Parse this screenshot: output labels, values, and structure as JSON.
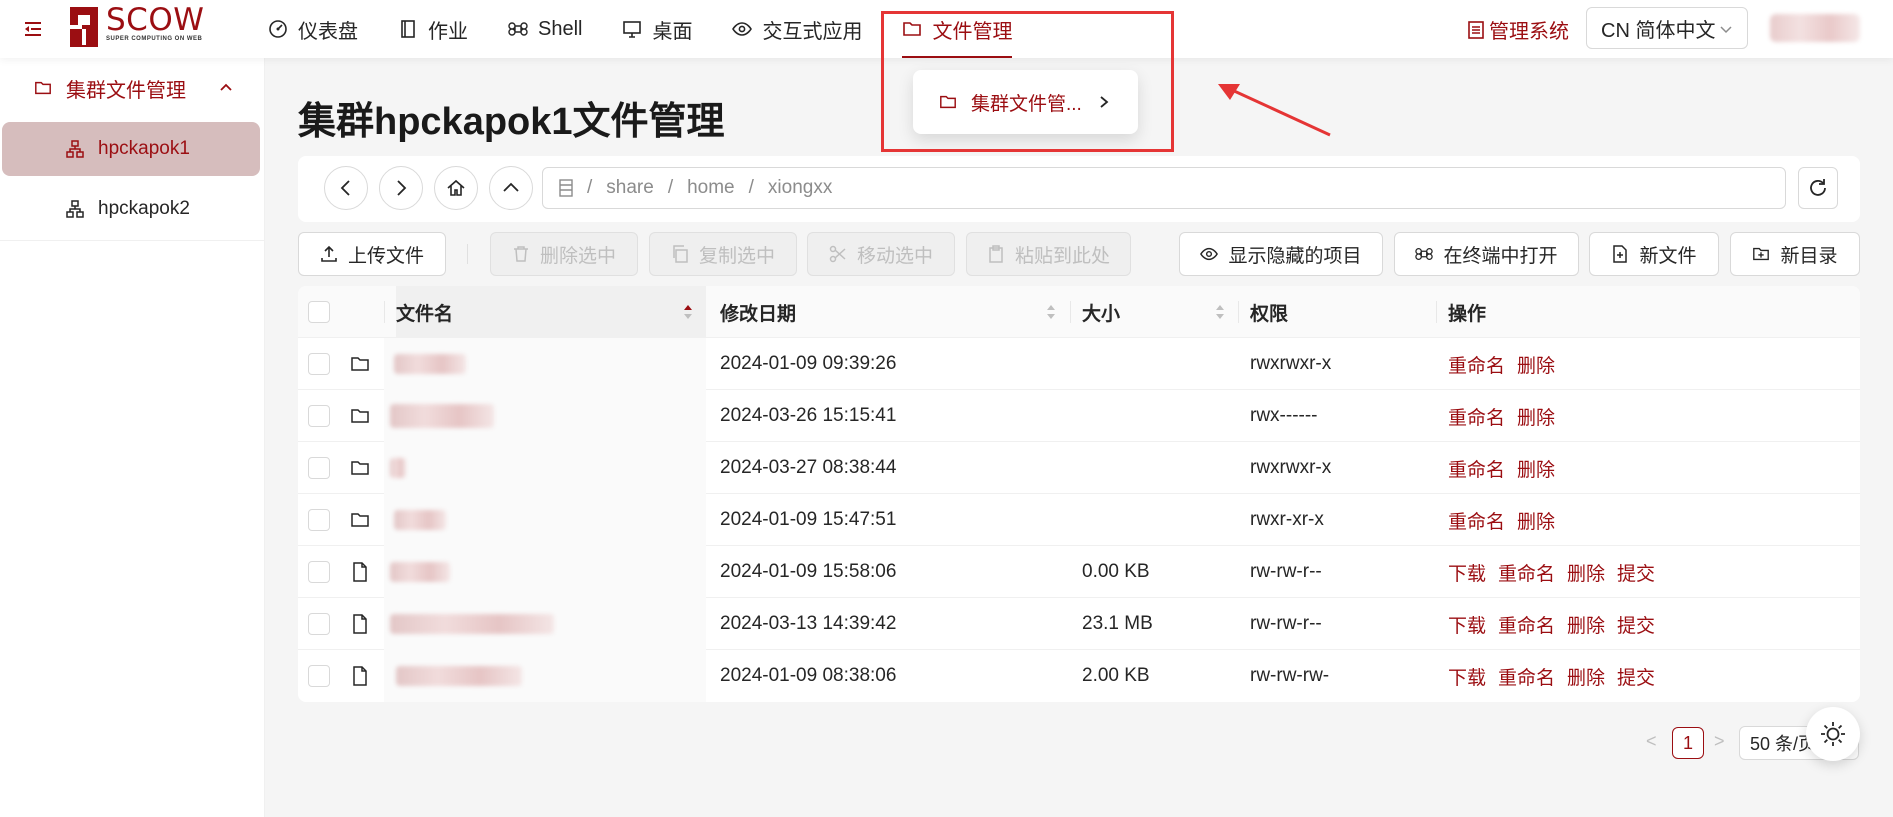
{
  "header": {
    "logo_text": "SCOW",
    "logo_subtitle": "SUPER COMPUTING ON WEB",
    "nav": [
      {
        "label": "仪表盘",
        "icon": "dashboard-icon"
      },
      {
        "label": "作业",
        "icon": "book-icon"
      },
      {
        "label": "Shell",
        "icon": "command-icon"
      },
      {
        "label": "桌面",
        "icon": "desktop-icon"
      },
      {
        "label": "交互式应用",
        "icon": "eye-icon"
      },
      {
        "label": "文件管理",
        "icon": "folder-icon",
        "active": true
      }
    ],
    "admin_link": "管理系统",
    "language": "CN 简体中文"
  },
  "dropdown": {
    "item": "集群文件管..."
  },
  "sidebar": {
    "group": "集群文件管理",
    "items": [
      {
        "label": "hpckapok1",
        "active": true
      },
      {
        "label": "hpckapok2",
        "active": false
      }
    ]
  },
  "main": {
    "title": "集群hpckapok1文件管理",
    "path": [
      "share",
      "home",
      "xiongxx"
    ],
    "toolbar": {
      "upload": "上传文件",
      "delete": "删除选中",
      "copy": "复制选中",
      "move": "移动选中",
      "paste": "粘贴到此处",
      "show_hidden": "显示隐藏的项目",
      "open_terminal": "在终端中打开",
      "new_file": "新文件",
      "new_dir": "新目录"
    },
    "table": {
      "headers": {
        "name": "文件名",
        "modified": "修改日期",
        "size": "大小",
        "perm": "权限",
        "actions": "操作"
      },
      "rows": [
        {
          "type": "dir",
          "modified": "2024-01-09 09:39:26",
          "size": "",
          "perm": "rwxrwxr-x"
        },
        {
          "type": "dir",
          "modified": "2024-03-26 15:15:41",
          "size": "",
          "perm": "rwx------"
        },
        {
          "type": "dir",
          "modified": "2024-03-27 08:38:44",
          "size": "",
          "perm": "rwxrwxr-x"
        },
        {
          "type": "dir",
          "modified": "2024-01-09 15:47:51",
          "size": "",
          "perm": "rwxr-xr-x"
        },
        {
          "type": "file",
          "modified": "2024-01-09 15:58:06",
          "size": "0.00 KB",
          "perm": "rw-rw-r--"
        },
        {
          "type": "file",
          "modified": "2024-03-13 14:39:42",
          "size": "23.1 MB",
          "perm": "rw-rw-r--"
        },
        {
          "type": "file",
          "modified": "2024-01-09 08:38:06",
          "size": "2.00 KB",
          "perm": "rw-rw-rw-"
        }
      ],
      "actions": {
        "download": "下载",
        "rename": "重命名",
        "delete": "删除",
        "submit": "提交"
      }
    },
    "pagination": {
      "prev": "<",
      "page": "1",
      "next": ">",
      "page_size": "50 条/页"
    }
  },
  "colors": {
    "accent": "#9b0e12",
    "annotation": "#e53535"
  }
}
